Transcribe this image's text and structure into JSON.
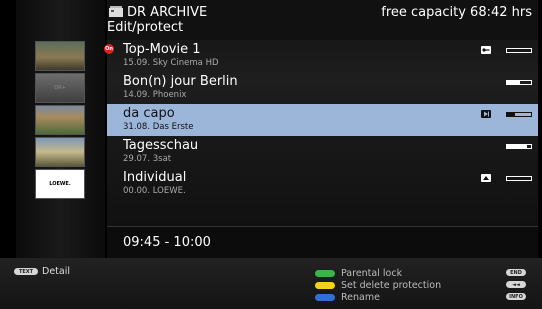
{
  "header": {
    "title": "DR ARCHIVE",
    "subtitle": "Edit/protect",
    "capacity": "free capacity 68:42 hrs"
  },
  "thumbnails": [
    {
      "label": ""
    },
    {
      "label": "DR+"
    },
    {
      "label": ""
    },
    {
      "label": ""
    },
    {
      "label": "LOEWE."
    }
  ],
  "recordings": [
    {
      "title": "Top-Movie 1",
      "meta": "15.09.  Sky Cinema HD",
      "badge": "On",
      "status_icon": "key-icon",
      "progress": 0.0,
      "selected": false
    },
    {
      "title": "Bon(n) jour Berlin",
      "meta": "14.09.  Phoenix",
      "status_icon": "",
      "progress": 0.55,
      "selected": false
    },
    {
      "title": "da capo",
      "meta": "31.08.  Das Erste",
      "status_icon": "play-icon",
      "progress": 0.35,
      "selected": true
    },
    {
      "title": "Tagesschau",
      "meta": "29.07.  3sat",
      "status_icon": "",
      "progress": 0.85,
      "selected": false
    },
    {
      "title": "Individual",
      "meta": "00.00.  LOEWE.",
      "status_icon": "protect-icon",
      "progress": 0.0,
      "selected": false
    }
  ],
  "time_range": "09:45 - 10:00",
  "footer": {
    "detail_key": "TEXT",
    "detail_label": "Detail",
    "actions": [
      {
        "label": "Parental lock",
        "color": "#39b54a"
      },
      {
        "label": "Set delete protection",
        "color": "#f2d21b"
      },
      {
        "label": "Rename",
        "color": "#2f6fd6"
      }
    ],
    "right_keys": [
      "END",
      "◄◄",
      "INFO"
    ]
  },
  "colors": {
    "selection": "#9cb6da",
    "onair_badge": "#e02020"
  }
}
